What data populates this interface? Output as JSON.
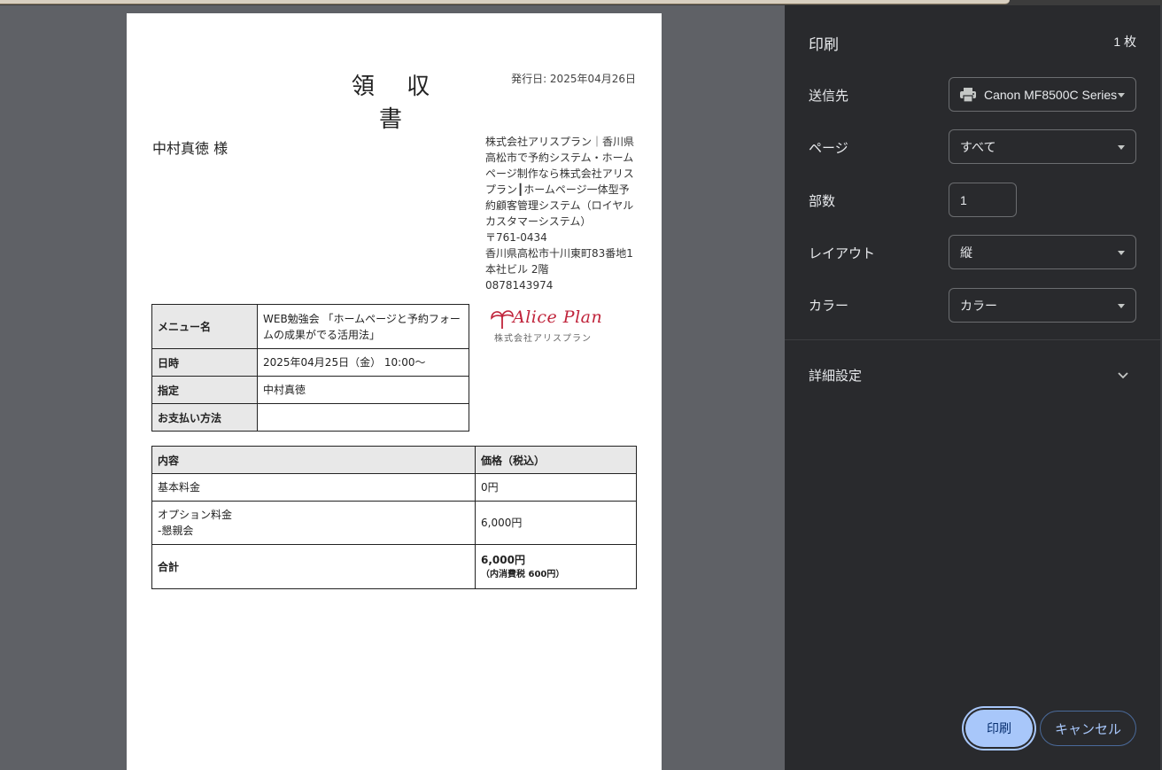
{
  "receipt": {
    "title": "領 収 書",
    "issue_date": "発行日: 2025年04月26日",
    "recipient": "中村真徳 様",
    "company_lines": [
      "株式会社アリスプラン｜香川県",
      "高松市で予約システム・ホーム",
      "ページ制作なら株式会社アリス",
      "プラン┃ホームページ一体型予",
      "約顧客管理システム（ロイヤル",
      "カスタマーシステム）",
      "〒761-0434",
      "香川県高松市十川東町83番地1",
      "本社ビル 2階",
      "0878143974"
    ],
    "logo": {
      "main": "Alice Plan",
      "sub": "株式会社アリスプラン",
      "color": "#c0243b"
    },
    "info_rows": [
      {
        "label": "メニュー名",
        "value_lines": [
          "WEB勉強会 「ホームページと予約フォー",
          "ムの成果がでる活用法」"
        ]
      },
      {
        "label": "日時",
        "value_lines": [
          "2025年04月25日（金） 10:00〜"
        ]
      },
      {
        "label": "指定",
        "value_lines": [
          "中村真徳"
        ]
      },
      {
        "label": "お支払い方法",
        "value_lines": [
          ""
        ]
      }
    ],
    "price_table": {
      "headers": [
        "内容",
        "価格（税込）"
      ],
      "rows": [
        {
          "item_lines": [
            "基本料金"
          ],
          "price": "0円"
        },
        {
          "item_lines": [
            "オプション料金",
            "-懇親会"
          ],
          "price": "6,000円"
        }
      ],
      "total": {
        "label": "合計",
        "price": "6,000円",
        "tax_note": "（内消費税 600円）"
      }
    }
  },
  "print_panel": {
    "title": "印刷",
    "sheet_count": "1 枚",
    "destination": {
      "label": "送信先",
      "value": "Canon MF8500C Series"
    },
    "pages": {
      "label": "ページ",
      "value": "すべて"
    },
    "copies": {
      "label": "部数",
      "value": "1"
    },
    "layout": {
      "label": "レイアウト",
      "value": "縦"
    },
    "color": {
      "label": "カラー",
      "value": "カラー"
    },
    "advanced": {
      "label": "詳細設定"
    },
    "print_button": "印刷",
    "cancel_button": "キャンセル",
    "accent_color": "#a8c7fa"
  }
}
